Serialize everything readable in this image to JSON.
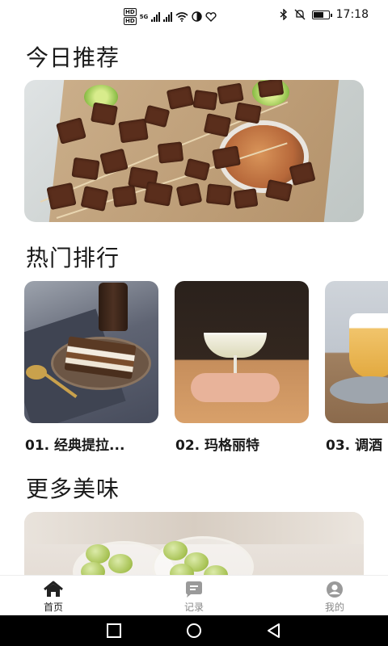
{
  "status_bar": {
    "time": "17:18",
    "icons": [
      "hd-icon",
      "signal-5g-icon",
      "signal-icon",
      "wifi-icon",
      "data-saver-icon",
      "heart-icon",
      "bluetooth-icon",
      "mute-icon",
      "battery-icon"
    ],
    "network_label_1": "HD",
    "network_label_2": "HD",
    "signal_label": "5G",
    "battery_level": 0.7
  },
  "sections": {
    "today": {
      "title": "今日推荐"
    },
    "popular": {
      "title": "热门排行"
    },
    "more": {
      "title": "更多美味"
    }
  },
  "popular_items": [
    {
      "rank": "01.",
      "name": "经典提拉..."
    },
    {
      "rank": "02.",
      "name": "玛格丽特"
    },
    {
      "rank": "03.",
      "name": "调酒"
    }
  ],
  "tabbar": {
    "items": [
      {
        "label": "首页",
        "icon": "home-icon",
        "active": true
      },
      {
        "label": "记录",
        "icon": "chat-bubble-icon",
        "active": false
      },
      {
        "label": "我的",
        "icon": "user-icon",
        "active": false
      }
    ]
  },
  "nav_bar": {
    "buttons": [
      "recent-apps-icon",
      "home-circle-icon",
      "back-triangle-icon"
    ]
  },
  "colors": {
    "text": "#1a1a1a",
    "tab_active": "#222222",
    "tab_inactive": "#888888",
    "nav_background": "#000000"
  }
}
